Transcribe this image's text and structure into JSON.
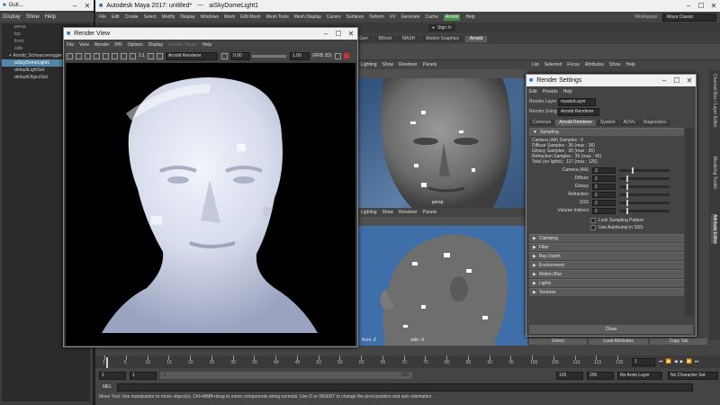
{
  "outliner": {
    "title": "Outl...",
    "menu": [
      "Display",
      "Show",
      "Help"
    ],
    "items": [
      "persp",
      "top",
      "front",
      "side",
      "Arnold_Schwarzenegger",
      "aiSkyDomeLight1",
      "defaultLightSet",
      "defaultObjectSet"
    ],
    "selected_index": 5
  },
  "maya": {
    "title": "Autodesk Maya 2017: untitled*",
    "title_sep": "---",
    "title_obj": "aiSkyDomeLight1",
    "menu": [
      "File",
      "Edit",
      "Create",
      "Select",
      "Modify",
      "Display",
      "Windows",
      "Mesh",
      "Edit Mesh",
      "Mesh Tools",
      "Mesh Display",
      "Curves",
      "Surfaces",
      "Deform",
      "UV",
      "Generate",
      "Cache",
      "Arnold",
      "Help"
    ],
    "workspace_label": "Workspace :",
    "workspace_value": "Maya Classic",
    "signin": "Sign In",
    "shelf_tabs": [
      "XGen",
      "Bifrost",
      "MASH",
      "Motion Graphics",
      "Arnold"
    ],
    "active_shelf": "Arnold"
  },
  "render_view": {
    "title": "Render View",
    "menu": [
      "File",
      "View",
      "Render",
      "IPR",
      "Options",
      "Display",
      "Help"
    ],
    "menu_disabled": "Render Target",
    "ratio": "1:1",
    "renderer": "Arnold Renderer",
    "exposure": "0.00",
    "gamma": "1.00",
    "colorspace": "(RRB 3D)"
  },
  "viewport_top": {
    "menu": [
      "Lighting",
      "Show",
      "Renderer",
      "Panels"
    ],
    "camera": "persp"
  },
  "viewport_bottom": {
    "menu": [
      "Lighting",
      "Show",
      "Renderer",
      "Panels"
    ],
    "left_label": "front -Z",
    "right_label": "side -X"
  },
  "attr_panel": {
    "menu": [
      "List",
      "Selected",
      "Focus",
      "Attributes",
      "Show",
      "Help"
    ],
    "side_tabs": [
      "Channel Box / Layer Editor",
      "Modeling Toolkit",
      "Attribute Editor"
    ],
    "buttons": [
      "Select",
      "Load Attributes",
      "Copy Tab"
    ]
  },
  "render_settings": {
    "title": "Render Settings",
    "menu": [
      "Edit",
      "Presets",
      "Help"
    ],
    "layer_label": "Render Layer",
    "layer_value": "masterLayer",
    "using_label": "Render Using",
    "using_value": "Arnold Renderer",
    "tabs": [
      "Common",
      "Arnold Renderer",
      "System",
      "AOVs",
      "Diagnostics"
    ],
    "active_tab": "Arnold Renderer",
    "sampling_header": "Sampling",
    "sampling_info": [
      "Camera (AA) Samples : 9",
      "Diffuse Samples : 36 (max : 36)",
      "Glossy Samples : 36 (max : 36)",
      "Refraction Samples : 36 (max : 45)",
      "Total (no lights) : 117 (max : 126)"
    ],
    "sampling_rows": [
      {
        "label": "Camera (AA)",
        "value": "3",
        "fill": 0.25
      },
      {
        "label": "Diffuse",
        "value": "2",
        "fill": 0.15
      },
      {
        "label": "Glossy",
        "value": "2",
        "fill": 0.15
      },
      {
        "label": "Refraction",
        "value": "2",
        "fill": 0.15
      },
      {
        "label": "SSS",
        "value": "2",
        "fill": 0.15
      },
      {
        "label": "Volume Indirect",
        "value": "2",
        "fill": 0.15
      }
    ],
    "checkboxes": [
      "Lock Sampling Pattern",
      "Use Autobump in SSS"
    ],
    "sections": [
      "Clamping",
      "Filter",
      "Ray Depth",
      "Environment",
      "Motion Blur",
      "Lights",
      "Textures"
    ],
    "close": "Close"
  },
  "timeline": {
    "ticks": [
      "1",
      "5",
      "10",
      "15",
      "20",
      "25",
      "30",
      "35",
      "40",
      "45",
      "50",
      "55",
      "60",
      "65",
      "70",
      "75",
      "80",
      "85",
      "90",
      "95",
      "100",
      "105",
      "110",
      "115",
      "120"
    ],
    "current_frame": "1"
  },
  "range": {
    "start": "1",
    "start2": "1",
    "slider_start": "1",
    "slider_end": "120",
    "end": "120",
    "end2": "200",
    "anim_layer": "No Anim Layer",
    "char_set": "No Character Set"
  },
  "command": {
    "label": "MEL"
  },
  "help_line": "Move Tool: Use manipulator to move object(s). Ctrl+MMB+drag to move components along normals. Use D or INSERT to change the pivot position and axis orientation.",
  "colors": {
    "maya_bg": "#444444",
    "accent": "#5285a6",
    "selected": "#5285a6",
    "viewport_blue": "#3f6fa8",
    "arnold_green": "#4a8a4a"
  }
}
